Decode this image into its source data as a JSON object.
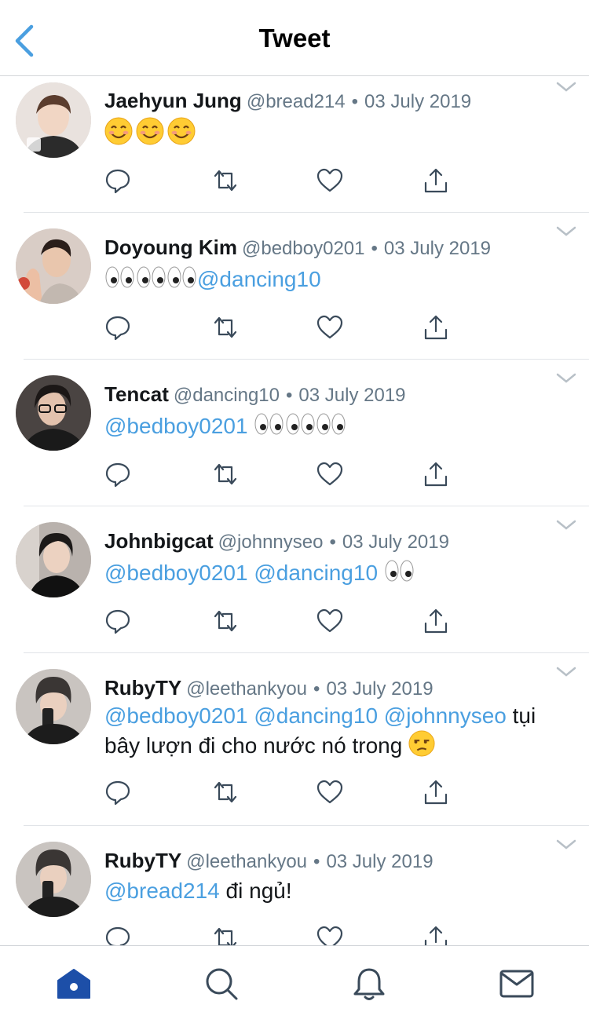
{
  "header": {
    "title": "Tweet"
  },
  "icons": {
    "back": "back-chevron-icon",
    "reply": "reply-icon",
    "retweet": "retweet-icon",
    "like": "heart-icon",
    "share": "share-icon",
    "caret": "chevron-down-icon"
  },
  "colors": {
    "link": "#4a9fe0",
    "accent": "#1d4fa8",
    "muted": "#657786"
  },
  "tweets": [
    {
      "name": "Jaehyun Jung",
      "handle": "@bread214",
      "sep": "•",
      "date": "03 July 2019",
      "emoji": "smiling-face-x3"
    },
    {
      "name": "Doyoung Kim",
      "handle": "@bedboy0201",
      "sep": "•",
      "date": "03 July 2019",
      "mention1": "@dancing10",
      "emoji": "eyes-x3"
    },
    {
      "name": "Tencat",
      "handle": "@dancing10",
      "sep": "•",
      "date": "03 July 2019",
      "mention1": "@bedboy0201",
      "emoji": "eyes-x3"
    },
    {
      "name": "Johnbigcat",
      "handle": "@johnnyseo",
      "sep": "•",
      "date": "03 July 2019",
      "mention1": "@bedboy0201",
      "mention2": "@dancing10",
      "emoji": "eyes-x1"
    },
    {
      "name": "RubyTY",
      "handle": "@leethankyou",
      "sep": "•",
      "date": "03 July 2019",
      "mention1": "@bedboy0201",
      "mention2": "@dancing10",
      "mention3": "@johnnyseo",
      "text": "tụi bây lượn đi cho nước nó trong",
      "emoji": "unamused-face"
    },
    {
      "name": "RubyTY",
      "handle": "@leethankyou",
      "sep": "•",
      "date": "03 July 2019",
      "mention1": "@bread214",
      "text": "đi ngủ!"
    }
  ],
  "tabbar": {
    "home": "home-icon",
    "search": "search-icon",
    "notifications": "bell-icon",
    "messages": "mail-icon"
  }
}
